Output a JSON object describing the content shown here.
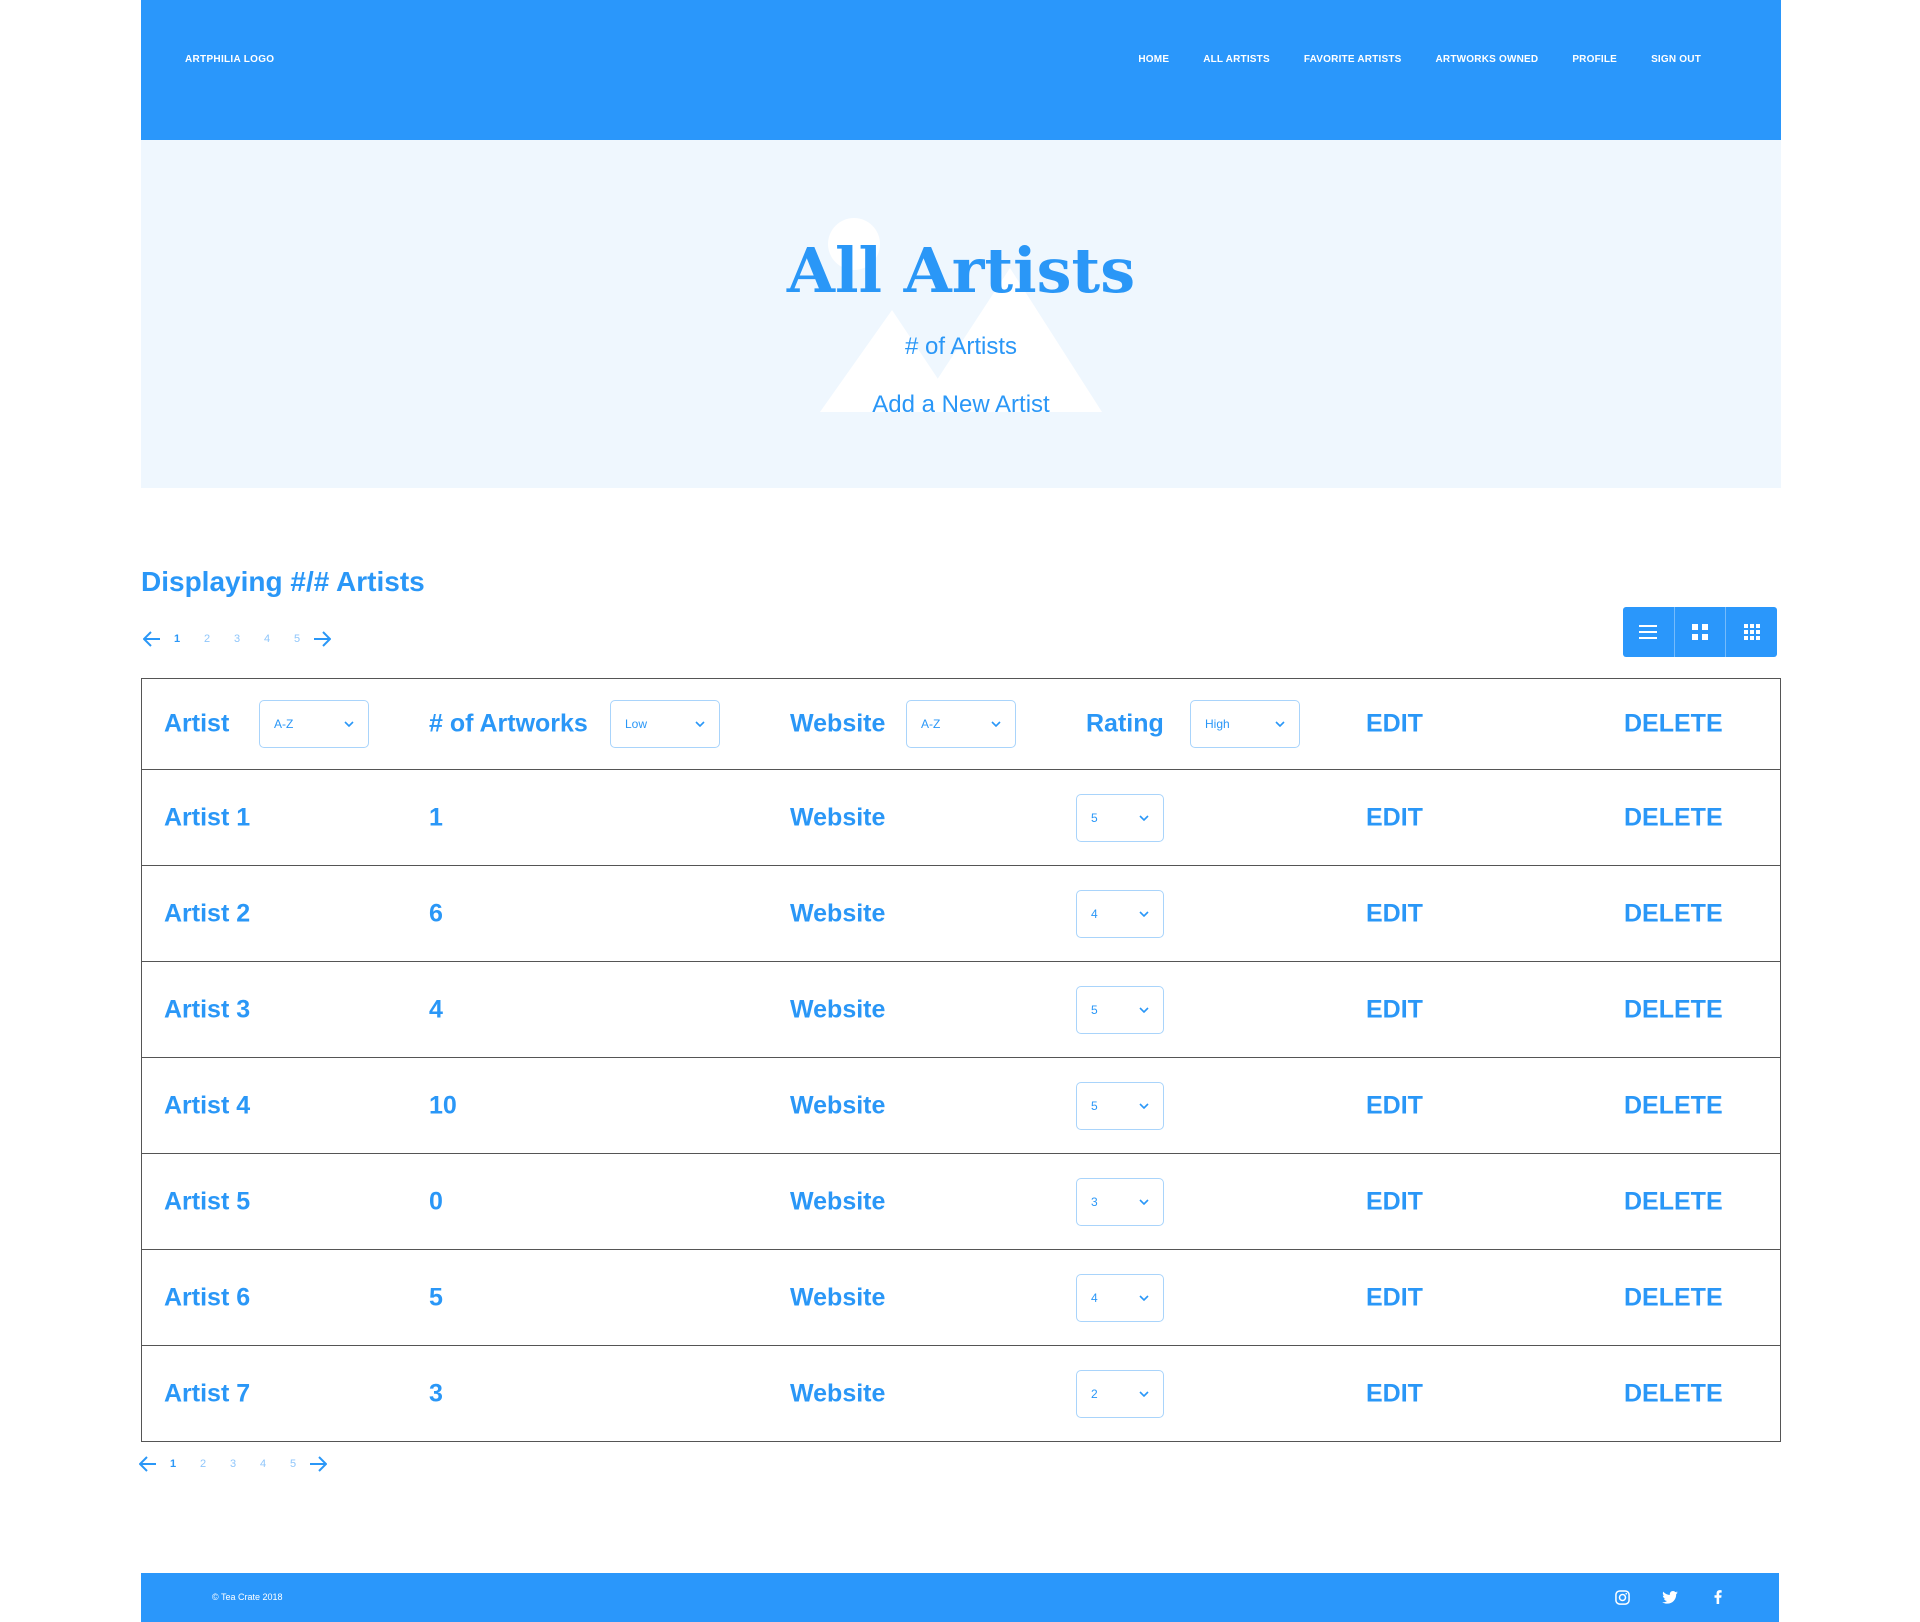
{
  "header": {
    "logo": "ARTPHILIA LOGO",
    "nav": [
      "HOME",
      "ALL ARTISTS",
      "FAVORITE ARTISTS",
      "ARTWORKS OWNED",
      "PROFILE",
      "SIGN OUT"
    ]
  },
  "hero": {
    "title": "All Artists",
    "subtitle": "# of Artists",
    "add_link": "Add a New Artist"
  },
  "display_title": "Displaying #/# Artists",
  "pagination": {
    "pages": [
      "1",
      "2",
      "3",
      "4",
      "5"
    ],
    "active": "1"
  },
  "view_toggle": [
    "list-view-icon",
    "grid-view-icon",
    "compact-grid-view-icon"
  ],
  "table": {
    "headers": {
      "artist": "Artist",
      "artist_sort": "A-Z",
      "count": "# of Artworks",
      "count_sort": "Low",
      "website": "Website",
      "website_sort": "A-Z",
      "rating": "Rating",
      "rating_sort": "High",
      "edit": "EDIT",
      "delete": "DELETE"
    },
    "rows": [
      {
        "artist": "Artist 1",
        "count": "1",
        "website": "Website",
        "rating": "5",
        "edit": "EDIT",
        "delete": "DELETE"
      },
      {
        "artist": "Artist 2",
        "count": "6",
        "website": "Website",
        "rating": "4",
        "edit": "EDIT",
        "delete": "DELETE"
      },
      {
        "artist": "Artist 3",
        "count": "4",
        "website": "Website",
        "rating": "5",
        "edit": "EDIT",
        "delete": "DELETE"
      },
      {
        "artist": "Artist 4",
        "count": "10",
        "website": "Website",
        "rating": "5",
        "edit": "EDIT",
        "delete": "DELETE"
      },
      {
        "artist": "Artist 5",
        "count": "0",
        "website": "Website",
        "rating": "3",
        "edit": "EDIT",
        "delete": "DELETE"
      },
      {
        "artist": "Artist 6",
        "count": "5",
        "website": "Website",
        "rating": "4",
        "edit": "EDIT",
        "delete": "DELETE"
      },
      {
        "artist": "Artist 7",
        "count": "3",
        "website": "Website",
        "rating": "2",
        "edit": "EDIT",
        "delete": "DELETE"
      }
    ]
  },
  "footer": {
    "copyright": "© Tea Crate 2018",
    "social": [
      "instagram-icon",
      "twitter-icon",
      "facebook-icon"
    ]
  },
  "colors": {
    "primary": "#2a97fb",
    "hero_bg": "#eff7fe",
    "light_text": "#8fc6fb",
    "border": "#555555"
  }
}
